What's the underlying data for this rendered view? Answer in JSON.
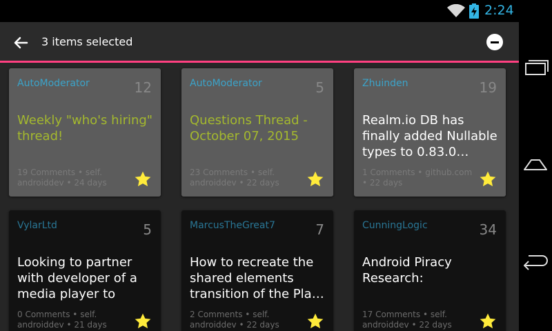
{
  "status_bar": {
    "time": "2:24",
    "icons": [
      "wifi-icon",
      "battery-icon"
    ]
  },
  "action_bar": {
    "title": "3 items selected",
    "back_icon": "arrow-left-icon",
    "deselect_icon": "minus-circle-icon"
  },
  "colors": {
    "accent": "#ff4081",
    "time": "#33b5e5",
    "author": "#33b5e5",
    "highlight_title": "#a4b92e",
    "star": "#ffeb3b"
  },
  "cards": [
    {
      "author": "AutoModerator",
      "score": "12",
      "title": "Weekly \"who's hiring\" thread!",
      "meta1": "19 Comments • self.",
      "meta2": "androiddev • 24 days",
      "selected": true,
      "highlight": true
    },
    {
      "author": "AutoModerator",
      "score": "5",
      "title": "Questions Thread - October 07, 2015",
      "meta1": "23 Comments • self.",
      "meta2": "androiddev • 22 days",
      "selected": true,
      "highlight": true
    },
    {
      "author": "Zhuinden",
      "score": "19",
      "title": "Realm.io DB has finally added Nullable types to 0.83.0…",
      "meta1": "1 Comments • github.com",
      "meta2": "• 22 days",
      "selected": true,
      "highlight": false
    },
    {
      "author": "VylarLtd",
      "score": "5",
      "title": "Looking to partner with developer of a media player to mak…",
      "meta1": "0 Comments • self.",
      "meta2": "androiddev • 21 days",
      "selected": false,
      "highlight": false
    },
    {
      "author": "MarcusTheGreat7",
      "score": "7",
      "title": "How to recreate the shared elements transition of the Pla…",
      "meta1": "2 Comments • self.",
      "meta2": "androiddev • 22 days",
      "selected": false,
      "highlight": false
    },
    {
      "author": "CunningLogic",
      "score": "34",
      "title": "Android Piracy Research:",
      "meta1": "17 Comments • self.",
      "meta2": "androiddev • 22 days",
      "selected": false,
      "highlight": false
    }
  ],
  "nav_bar": {
    "buttons": [
      "recent-apps-icon",
      "home-icon",
      "back-icon"
    ]
  }
}
